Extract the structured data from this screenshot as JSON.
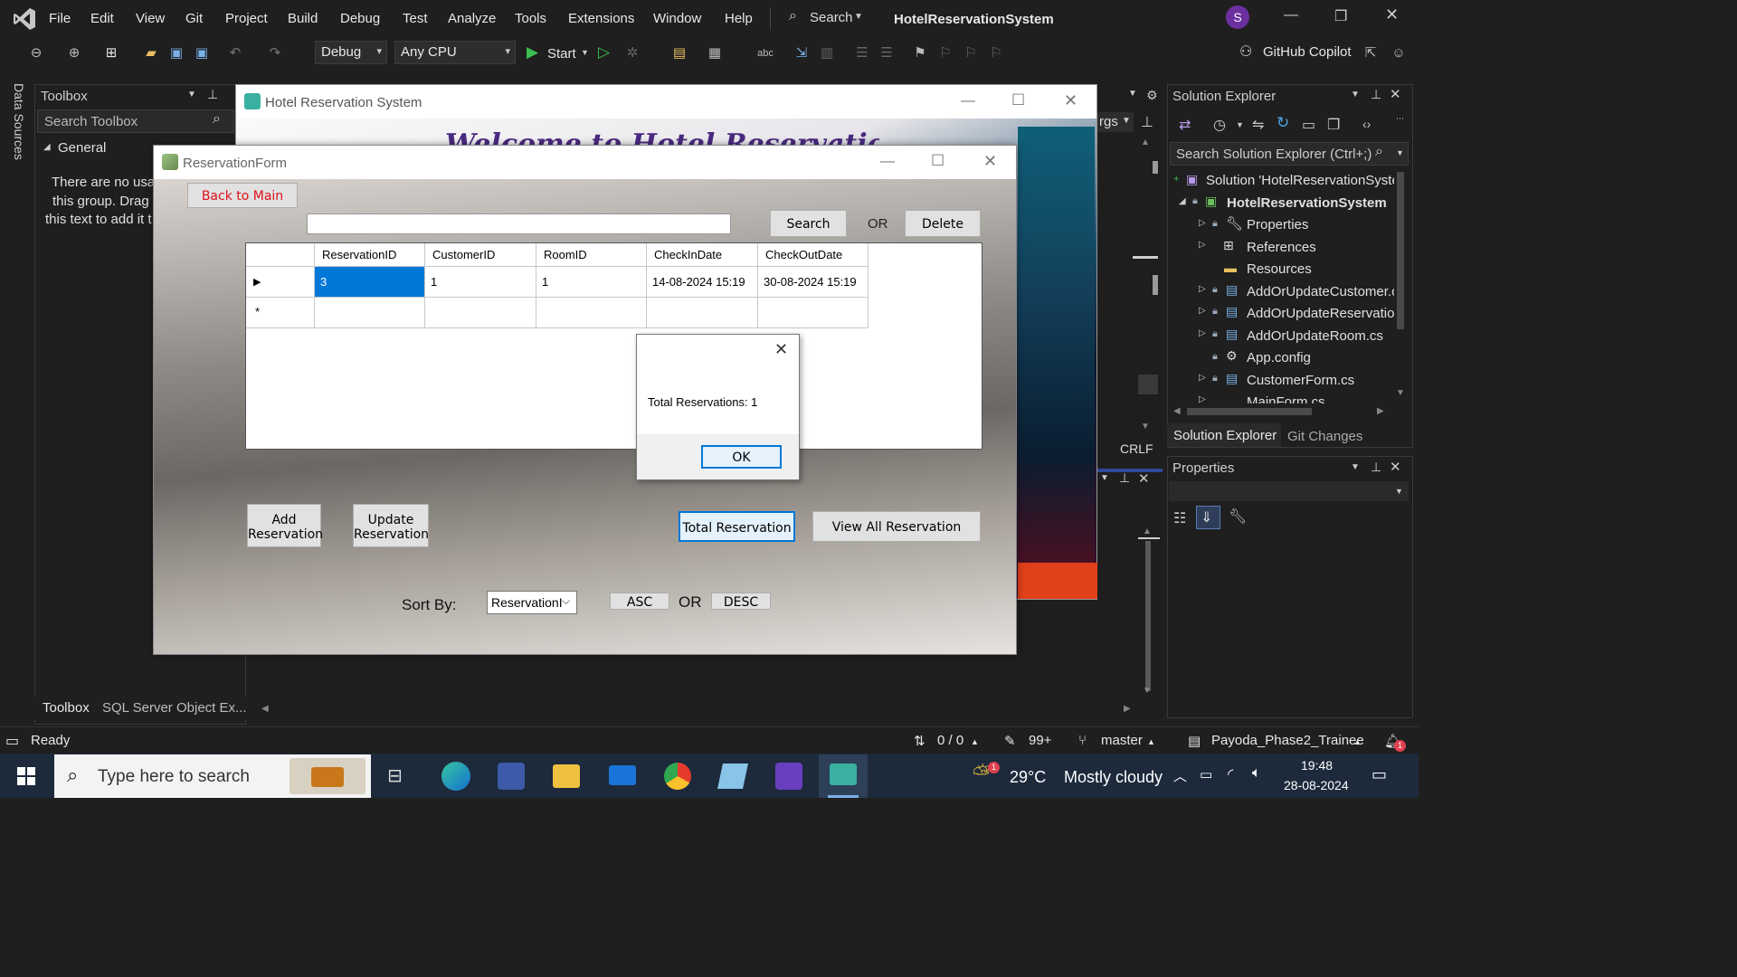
{
  "vs": {
    "menu": [
      "File",
      "Edit",
      "View",
      "Git",
      "Project",
      "Build",
      "Debug",
      "Test",
      "Analyze",
      "Tools",
      "Extensions",
      "Window",
      "Help"
    ],
    "search_label": "Search",
    "solution_title": "HotelReservationSystem",
    "user_initial": "S",
    "config": "Debug",
    "platform": "Any CPU",
    "start_label": "Start",
    "copilot_label": "GitHub Copilot",
    "data_sources": "Data Sources",
    "partial_tab": "rgs",
    "crlf": "CRLF"
  },
  "toolbox": {
    "title": "Toolbox",
    "search_placeholder": "Search Toolbox",
    "group": "General",
    "empty_line1": "There are no usab",
    "empty_line2": "this group. Drag",
    "empty_line3": "this text to add it t",
    "tab_toolbox": "Toolbox",
    "tab_sql": "SQL Server Object Ex..."
  },
  "solution_explorer": {
    "title": "Solution Explorer",
    "search_placeholder": "Search Solution Explorer (Ctrl+;)",
    "items": [
      {
        "label": "Solution 'HotelReservationSyste"
      },
      {
        "label": "HotelReservationSystem"
      },
      {
        "label": "Properties"
      },
      {
        "label": "References"
      },
      {
        "label": "Resources"
      },
      {
        "label": "AddOrUpdateCustomer.c"
      },
      {
        "label": "AddOrUpdateReservatio"
      },
      {
        "label": "AddOrUpdateRoom.cs"
      },
      {
        "label": "App.config"
      },
      {
        "label": "CustomerForm.cs"
      },
      {
        "label": "MainForm.cs"
      }
    ],
    "tab_solution": "Solution Explorer",
    "tab_git": "Git Changes"
  },
  "properties": {
    "title": "Properties"
  },
  "status": {
    "ready": "Ready",
    "updown": "0 / 0",
    "pencil_count": "99+",
    "branch": "master",
    "repo": "Payoda_Phase2_Trainee"
  },
  "taskbar": {
    "search_placeholder": "Type here to search",
    "weather_temp": "29°C",
    "weather_desc": "Mostly cloudy",
    "weather_badge": "1",
    "time": "19:48",
    "date": "28-08-2024",
    "notif_badge": "1"
  },
  "hotel_window": {
    "title": "Hotel Reservation System",
    "banner_text": "Welcome to Hotel Reservation System"
  },
  "reservation_form": {
    "title": "ReservationForm",
    "back_button": "Back to Main",
    "search_value": "",
    "search_button": "Search",
    "or1": "OR",
    "delete_button": "Delete",
    "columns": [
      "ReservationID",
      "CustomerID",
      "RoomID",
      "CheckInDate",
      "CheckOutDate"
    ],
    "rows": [
      [
        "3",
        "1",
        "1",
        "14-08-2024 15:19",
        "30-08-2024 15:19"
      ]
    ],
    "add_line1": "Add",
    "add_line2": "Reservation",
    "update_line1": "Update",
    "update_line2": "Reservation",
    "total_button": "Total Reservation",
    "view_all_button": "View All Reservation",
    "sort_label": "Sort By:",
    "sort_value": "ReservationI",
    "asc_button": "ASC",
    "or2": "OR",
    "desc_button": "DESC"
  },
  "message_box": {
    "text": "Total Reservations: 1",
    "ok_button": "OK"
  }
}
